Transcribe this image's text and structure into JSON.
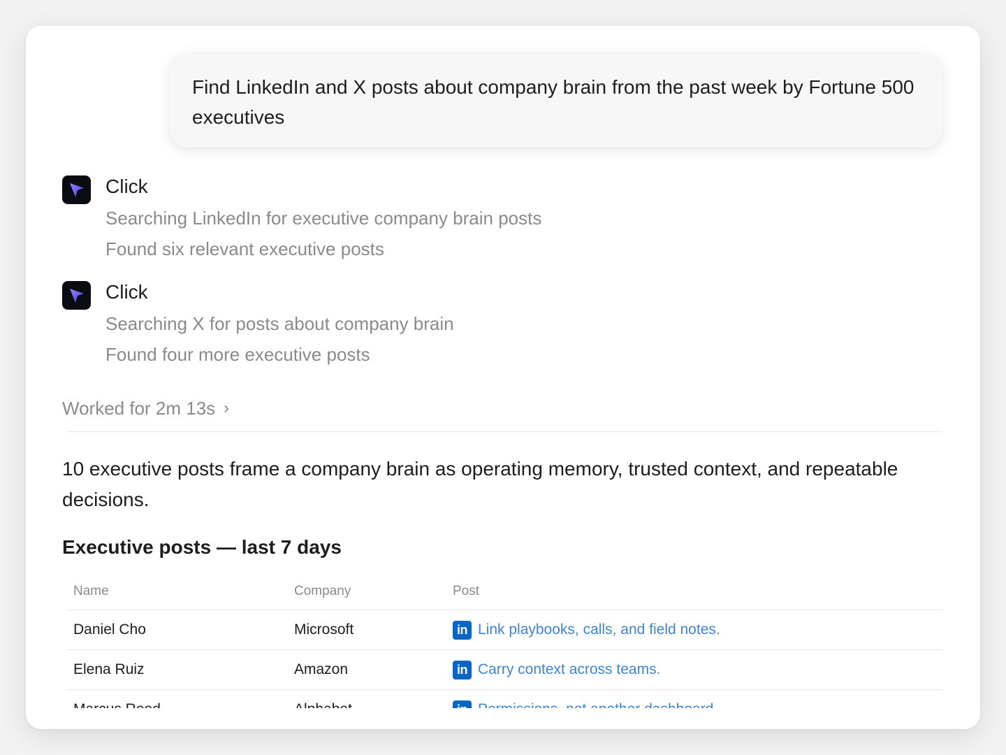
{
  "user_message": "Find LinkedIn and X posts about company brain from the past week by Fortune 500 executives",
  "steps": [
    {
      "title": "Click",
      "lines": [
        "Searching LinkedIn for executive company brain posts",
        "Found six relevant executive posts"
      ]
    },
    {
      "title": "Click",
      "lines": [
        "Searching X for posts about company brain",
        "Found four more executive posts"
      ]
    }
  ],
  "worked": {
    "label": "Worked for 2m 13s",
    "chevron": "›"
  },
  "summary": "10 executive posts frame a company brain as operating memory, trusted context, and repeatable decisions.",
  "section_title": "Executive posts — last 7 days",
  "table": {
    "columns": [
      "Name",
      "Company",
      "Post"
    ],
    "rows": [
      {
        "name": "Daniel Cho",
        "company": "Microsoft",
        "platform": "LinkedIn",
        "badge": "in",
        "post": "Link playbooks, calls, and field notes."
      },
      {
        "name": "Elena Ruiz",
        "company": "Amazon",
        "platform": "LinkedIn",
        "badge": "in",
        "post": "Carry context across teams."
      },
      {
        "name": "Marcus Reed",
        "company": "Alphabet",
        "platform": "LinkedIn",
        "badge": "in",
        "post": "Permissions, not another dashboard."
      }
    ]
  },
  "icons": {
    "step_icon": "cursor-arrow-icon",
    "linkedin": "linkedin-icon"
  },
  "colors": {
    "link": "#3f84d2",
    "linkedin": "#0a66c2",
    "muted_text": "#8a8a8e",
    "step_icon_bg": "#0b0b12",
    "cursor_gradient_start": "#8f86ff",
    "cursor_gradient_end": "#4d38d6"
  }
}
